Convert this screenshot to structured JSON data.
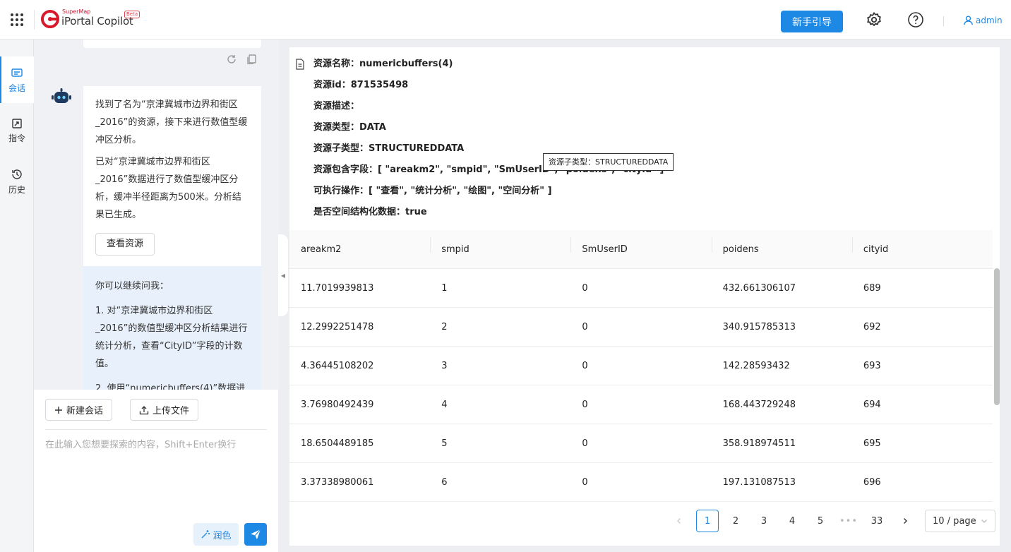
{
  "app": {
    "logo_small": "SuperMap",
    "logo_name": "iPortal Copilot",
    "logo_badge": "Beta",
    "guide_button": "新手引导",
    "user": "admin",
    "brand_color": "#1e88e5"
  },
  "sidebar": {
    "items": [
      {
        "label": "会话",
        "icon": "chat-icon",
        "active": true
      },
      {
        "label": "指令",
        "icon": "command-icon",
        "active": false
      },
      {
        "label": "历史",
        "icon": "history-icon",
        "active": false
      }
    ]
  },
  "chat": {
    "bot_message": {
      "p1": "找到了名为“京津冀城市边界和街区_2016”的资源，接下来进行数值型缓冲区分析。",
      "p2": "已对“京津冀城市边界和街区_2016”数据进行了数值型缓冲区分析，缓冲半径距离为500米。分析结果已生成。",
      "view_resource_button": "查看资源"
    },
    "suggestions": {
      "intro": "你可以继续问我：",
      "items": [
        "1. 对“京津冀城市边界和街区_2016”的数值型缓冲区分析结果进行统计分析，查看“CityID”字段的计数值。",
        "2. 使用“numericbuffers(4)”数据进行"
      ]
    }
  },
  "input": {
    "new_chat_button": "新建会话",
    "upload_button": "上传文件",
    "placeholder": "在此输入您想要探索的内容，Shift+Enter换行",
    "polish_button": "润色"
  },
  "resource": {
    "name": "资源名称：numericbuffers(4)",
    "id": "资源id：871535498",
    "desc": "资源描述：",
    "type": "资源类型：DATA",
    "subtype": "资源子类型：STRUCTUREDDATA",
    "fields": "资源包含字段：[ \"areakm2\", \"smpid\", \"SmUserID\", \"poidens\", \"cityid\" ]",
    "ops": "可执行操作：[ \"查看\", \"统计分析\", \"绘图\", \"空间分析\" ]",
    "spatial": "是否空间结构化数据：true",
    "tooltip": "资源子类型：STRUCTUREDDATA"
  },
  "table": {
    "headers": [
      "areakm2",
      "smpid",
      "SmUserID",
      "poidens",
      "cityid"
    ],
    "rows": [
      [
        "11.7019939813",
        "1",
        "0",
        "432.661306107",
        "689"
      ],
      [
        "12.2992251478",
        "2",
        "0",
        "340.915785313",
        "692"
      ],
      [
        "4.36445108202",
        "3",
        "0",
        "142.28593432",
        "693"
      ],
      [
        "3.76980492439",
        "4",
        "0",
        "168.443729248",
        "694"
      ],
      [
        "18.6504489185",
        "5",
        "0",
        "358.918974511",
        "695"
      ],
      [
        "3.37338980061",
        "6",
        "0",
        "197.131087513",
        "696"
      ]
    ]
  },
  "pagination": {
    "pages": [
      "1",
      "2",
      "3",
      "4",
      "5"
    ],
    "ellipsis": "•••",
    "last": "33",
    "current": "1",
    "page_size": "10 / page"
  }
}
